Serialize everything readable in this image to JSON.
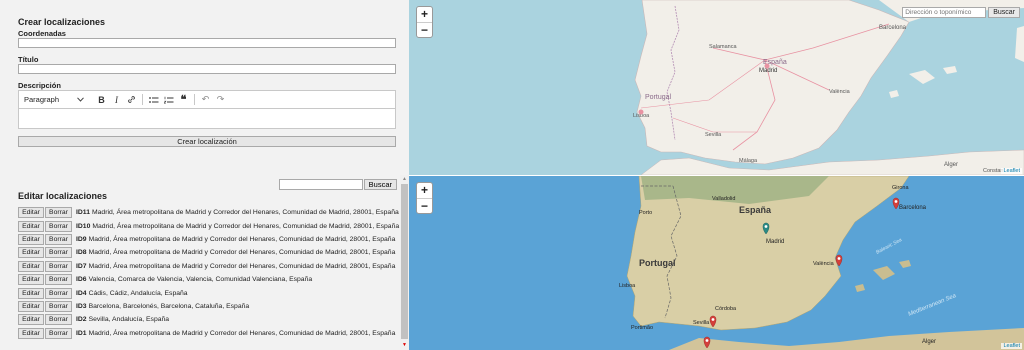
{
  "create": {
    "title": "Crear localizaciones",
    "coords_label": "Coordenadas",
    "title_label": "Título",
    "desc_label": "Descripción",
    "editor_block": "Paragraph",
    "editor_icons": [
      "chevron-down-icon",
      "bold-icon",
      "italic-icon",
      "link-icon",
      "bulleted-list-icon",
      "numbered-list-icon",
      "block-quote-icon",
      "undo-icon",
      "redo-icon"
    ],
    "submit_label": "Crear localización"
  },
  "edit": {
    "title": "Editar localizaciones",
    "search_button": "Buscar",
    "edit_label": "Editar",
    "delete_label": "Borrar",
    "items": [
      {
        "id": "ID11",
        "text": "Madrid, Área metropolitana de Madrid y Corredor del Henares, Comunidad de Madrid, 28001, España"
      },
      {
        "id": "ID10",
        "text": "Madrid, Área metropolitana de Madrid y Corredor del Henares, Comunidad de Madrid, 28001, España"
      },
      {
        "id": "ID9",
        "text": "Madrid, Área metropolitana de Madrid y Corredor del Henares, Comunidad de Madrid, 28001, España"
      },
      {
        "id": "ID8",
        "text": "Madrid, Área metropolitana de Madrid y Corredor del Henares, Comunidad de Madrid, 28001, España"
      },
      {
        "id": "ID7",
        "text": "Madrid, Área metropolitana de Madrid y Corredor del Henares, Comunidad de Madrid, 28001, España"
      },
      {
        "id": "ID6",
        "text": "Valencia, Comarca de Valencia, Valencia, Comunidad Valenciana, España"
      },
      {
        "id": "ID4",
        "text": "Cádis, Cádiz, Andalucía, España"
      },
      {
        "id": "ID3",
        "text": "Barcelona, Barcelonés, Barcelona, Cataluña, España"
      },
      {
        "id": "ID2",
        "text": "Sevilla, Andalucía, España"
      },
      {
        "id": "ID1",
        "text": "Madrid, Área metropolitana de Madrid y Corredor del Henares, Comunidad de Madrid, 28001, España"
      }
    ]
  },
  "map_top": {
    "zoom_in": "+",
    "zoom_out": "−",
    "search_placeholder": "Dirección o toponímico",
    "search_button": "Buscar",
    "attribution": "Leaflet",
    "labels": {
      "portugal": "Portugal",
      "espana": "España",
      "lisboa": "Lisboa",
      "salamanca": "Salamanca",
      "madrid": "Madrid",
      "valencia": "València",
      "barcelona": "Barcelona",
      "sevilla": "Sevilla",
      "malaga": "Málaga",
      "alger": "Alger",
      "constantine": "Constan"
    }
  },
  "map_bottom": {
    "zoom_in": "+",
    "zoom_out": "−",
    "attribution": "Leaflet",
    "labels": {
      "espana": "España",
      "portugal": "Portugal",
      "madrid": "Madrid",
      "barcelona": "Barcelona",
      "valencia": "València",
      "lisboa": "Lisboa",
      "valladolid": "Valladolid",
      "girona": "Girona",
      "cordoba": "Córdoba",
      "sevilla": "Sevilla",
      "alger": "Alger",
      "porto": "Porto",
      "portimao": "Portimão",
      "balearic": "Balearic Sea",
      "mediterranean": "Mediterranean Sea"
    },
    "markers": [
      "madrid-marker",
      "barcelona-marker",
      "valencia-marker",
      "sevilla-marker",
      "cadiz-marker"
    ]
  },
  "colors": {
    "panel_bg": "#f2f2f2",
    "osm_sea": "#aad3df",
    "osm_land": "#f2efe9",
    "sat_sea": "#5aa3d6",
    "sat_land": "#d9cfa6",
    "marker_red": "#d43f3a",
    "marker_teal": "#2a8a85"
  }
}
